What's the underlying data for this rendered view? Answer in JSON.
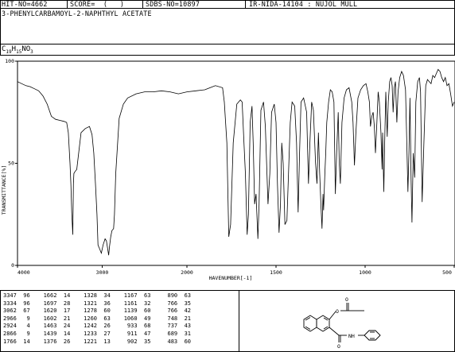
{
  "header": {
    "hit_no": "HIT-NO=4662",
    "score": "SCORE=  (   )",
    "sdbs_no": "SDBS-NO=10897",
    "ir_code": "IR-NIDA-14104 : NUJOL MULL",
    "compound_name": "3-PHENYLCARBAMOYL-2-NAPHTHYL ACETATE",
    "formula_main": "C",
    "formula_c": "19",
    "formula_h_label": "H",
    "formula_h": "15",
    "formula_n_label": "NO",
    "formula_o": "3"
  },
  "chart_data": {
    "type": "line",
    "title": "",
    "xlabel": "HAVENUMBER[-1]",
    "ylabel": "TRANSMITTANCE[%]",
    "xlim": [
      4000,
      500
    ],
    "ylim": [
      0,
      100
    ],
    "x_ticks": [
      "4000",
      "3000",
      "2000",
      "1500",
      "1000",
      "500"
    ],
    "y_ticks": [
      "100",
      "50",
      "0"
    ],
    "grid": false,
    "series": [
      {
        "name": "",
        "x": [
          4000,
          3950,
          3900,
          3850,
          3800,
          3750,
          3700,
          3650,
          3600,
          3550,
          3500,
          3450,
          3420,
          3400,
          3380,
          3370,
          3360,
          3347,
          3340,
          3334,
          3320,
          3300,
          3250,
          3200,
          3150,
          3120,
          3100,
          3080,
          3062,
          3050,
          3030,
          3010,
          2990,
          2966,
          2950,
          2935,
          2924,
          2915,
          2900,
          2885,
          2866,
          2855,
          2840,
          2800,
          2750,
          2700,
          2600,
          2500,
          2400,
          2300,
          2200,
          2100,
          2000,
          1950,
          1900,
          1870,
          1840,
          1800,
          1790,
          1776,
          1765,
          1755,
          1740,
          1720,
          1700,
          1690,
          1680,
          1672,
          1662,
          1655,
          1645,
          1635,
          1628,
          1620,
          1612,
          1602,
          1595,
          1585,
          1570,
          1560,
          1545,
          1535,
          1525,
          1510,
          1500,
          1492,
          1483,
          1475,
          1468,
          1460,
          1450,
          1439,
          1430,
          1420,
          1410,
          1395,
          1385,
          1376,
          1368,
          1360,
          1345,
          1328,
          1318,
          1310,
          1300,
          1290,
          1278,
          1270,
          1262,
          1255,
          1248,
          1242,
          1236,
          1233,
          1226,
          1221,
          1215,
          1205,
          1195,
          1185,
          1175,
          1167,
          1160,
          1151,
          1145,
          1139,
          1130,
          1118,
          1105,
          1090,
          1075,
          1068,
          1060,
          1052,
          1040,
          1025,
          1010,
          995,
          985,
          976,
          970,
          962,
          955,
          948,
          942,
          934,
          927,
          920,
          911,
          905,
          902,
          895,
          890,
          884,
          876,
          870,
          862,
          855,
          848,
          843,
          836,
          830,
          822,
          815,
          806,
          795,
          785,
          773,
          766,
          760,
          754,
          748,
          742,
          737,
          730,
          722,
          715,
          705,
          695,
          689,
          680,
          670,
          660,
          650,
          640,
          630,
          620,
          610,
          600,
          590,
          580,
          570,
          560,
          550,
          540,
          530,
          520,
          510,
          500
        ],
        "y": [
          90,
          89,
          88,
          87.5,
          86.5,
          85.5,
          83,
          79,
          73,
          71.5,
          71,
          70.5,
          70,
          65,
          50,
          40,
          26,
          15,
          40,
          45,
          46,
          47,
          65,
          67,
          68,
          64,
          55,
          40,
          25,
          10,
          8,
          6,
          10,
          13,
          12,
          8,
          5,
          9,
          14,
          17,
          18,
          25,
          45,
          72,
          79,
          82,
          84,
          85,
          85,
          85.5,
          85,
          84,
          85,
          85.5,
          86,
          87,
          88,
          87,
          80,
          60,
          14,
          20,
          60,
          79,
          81,
          80,
          60,
          45,
          15,
          25,
          70,
          78,
          60,
          30,
          35,
          13,
          30,
          76,
          80,
          68,
          30,
          45,
          75,
          79,
          70,
          40,
          16,
          30,
          60,
          50,
          20,
          22,
          45,
          70,
          80,
          78,
          60,
          26,
          55,
          80,
          82,
          75,
          40,
          60,
          80,
          76,
          50,
          40,
          65,
          45,
          30,
          18,
          35,
          27,
          45,
          55,
          70,
          80,
          86,
          85,
          80,
          35,
          55,
          75,
          50,
          40,
          70,
          82,
          86,
          87,
          80,
          70,
          49,
          65,
          82,
          86,
          88,
          89,
          85,
          80,
          68,
          73,
          75,
          68,
          55,
          70,
          85,
          80,
          65,
          47,
          65,
          36,
          60,
          85,
          63,
          80,
          90,
          92,
          88,
          75,
          87,
          90,
          70,
          85,
          92,
          95,
          93,
          86,
          60,
          36,
          55,
          82,
          42,
          21,
          55,
          43,
          80,
          90,
          92,
          85,
          31,
          60,
          88,
          91,
          90,
          89,
          93,
          92,
          94,
          96,
          95,
          92,
          90,
          92,
          88,
          89,
          84,
          78,
          80
        ]
      }
    ]
  },
  "peak_table": {
    "rows": [
      "3347  96    1662  14    1328  34    1167  63     890  63",
      "3334  96    1697  28    1321  36    1161  32     766  35",
      "3062  67    1620  17    1278  60    1139  60     766  42",
      "2966   9    1602  21    1260  63    1060  49     748  21",
      "2924   4    1463  24    1242  26     933  68     737  43",
      "2866   9    1439  14    1233  27     911  47     689  31",
      "1766  14    1376  26    1221  13     902  35     483  60"
    ]
  },
  "structure": {
    "labels": [
      "O",
      "C",
      "NH"
    ]
  }
}
